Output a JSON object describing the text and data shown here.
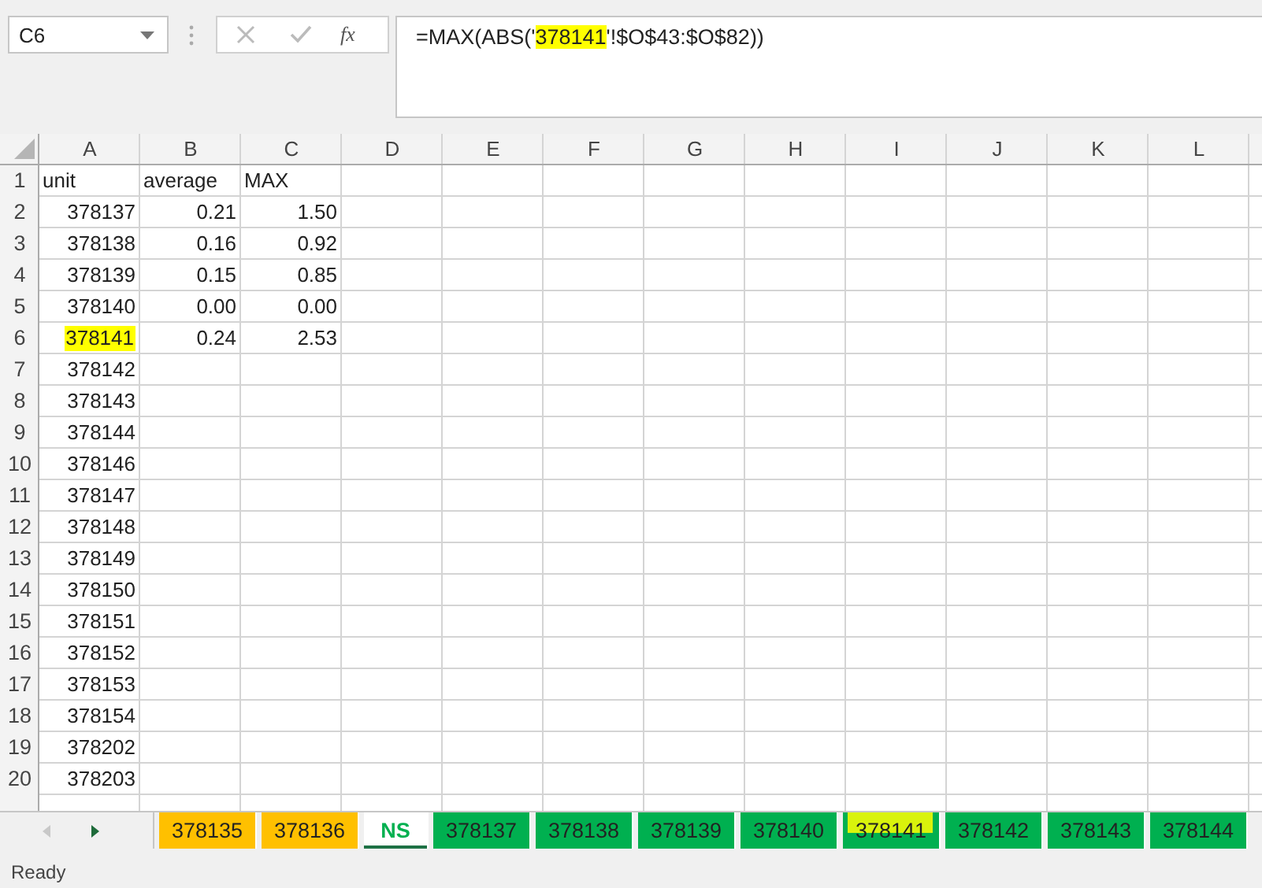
{
  "name_box": {
    "value": "C6"
  },
  "function_label": "fx",
  "formula": [
    {
      "text": "=MAX(ABS('",
      "highlighted": false
    },
    {
      "text": "378141",
      "highlighted": true
    },
    {
      "text": "'!$O$43:$O$82))",
      "highlighted": false
    }
  ],
  "columns": [
    "A",
    "B",
    "C",
    "D",
    "E",
    "F",
    "G",
    "H",
    "I",
    "J",
    "K",
    "L"
  ],
  "rows": [
    {
      "number": "1",
      "kind": "text",
      "cells": [
        {
          "text": "unit",
          "highlighted": false
        },
        {
          "text": "average",
          "highlighted": false
        },
        {
          "text": "MAX",
          "highlighted": false
        }
      ]
    },
    {
      "number": "2",
      "kind": "number",
      "cells": [
        {
          "text": "378137",
          "highlighted": false
        },
        {
          "text": "0.21",
          "highlighted": false
        },
        {
          "text": "1.50",
          "highlighted": false
        }
      ]
    },
    {
      "number": "3",
      "kind": "number",
      "cells": [
        {
          "text": "378138",
          "highlighted": false
        },
        {
          "text": "0.16",
          "highlighted": false
        },
        {
          "text": "0.92",
          "highlighted": false
        }
      ]
    },
    {
      "number": "4",
      "kind": "number",
      "cells": [
        {
          "text": "378139",
          "highlighted": false
        },
        {
          "text": "0.15",
          "highlighted": false
        },
        {
          "text": "0.85",
          "highlighted": false
        }
      ]
    },
    {
      "number": "5",
      "kind": "number",
      "cells": [
        {
          "text": "378140",
          "highlighted": false
        },
        {
          "text": "0.00",
          "highlighted": false
        },
        {
          "text": "0.00",
          "highlighted": false
        }
      ]
    },
    {
      "number": "6",
      "kind": "number",
      "cells": [
        {
          "text": "378141",
          "highlighted": true
        },
        {
          "text": "0.24",
          "highlighted": false
        },
        {
          "text": "2.53",
          "highlighted": false
        }
      ]
    },
    {
      "number": "7",
      "kind": "number",
      "cells": [
        {
          "text": "378142",
          "highlighted": false
        }
      ]
    },
    {
      "number": "8",
      "kind": "number",
      "cells": [
        {
          "text": "378143",
          "highlighted": false
        }
      ]
    },
    {
      "number": "9",
      "kind": "number",
      "cells": [
        {
          "text": "378144",
          "highlighted": false
        }
      ]
    },
    {
      "number": "10",
      "kind": "number",
      "cells": [
        {
          "text": "378146",
          "highlighted": false
        }
      ]
    },
    {
      "number": "11",
      "kind": "number",
      "cells": [
        {
          "text": "378147",
          "highlighted": false
        }
      ]
    },
    {
      "number": "12",
      "kind": "number",
      "cells": [
        {
          "text": "378148",
          "highlighted": false
        }
      ]
    },
    {
      "number": "13",
      "kind": "number",
      "cells": [
        {
          "text": "378149",
          "highlighted": false
        }
      ]
    },
    {
      "number": "14",
      "kind": "number",
      "cells": [
        {
          "text": "378150",
          "highlighted": false
        }
      ]
    },
    {
      "number": "15",
      "kind": "number",
      "cells": [
        {
          "text": "378151",
          "highlighted": false
        }
      ]
    },
    {
      "number": "16",
      "kind": "number",
      "cells": [
        {
          "text": "378152",
          "highlighted": false
        }
      ]
    },
    {
      "number": "17",
      "kind": "number",
      "cells": [
        {
          "text": "378153",
          "highlighted": false
        }
      ]
    },
    {
      "number": "18",
      "kind": "number",
      "cells": [
        {
          "text": "378154",
          "highlighted": false
        }
      ]
    },
    {
      "number": "19",
      "kind": "number",
      "cells": [
        {
          "text": "378202",
          "highlighted": false
        }
      ]
    },
    {
      "number": "20",
      "kind": "number",
      "cells": [
        {
          "text": "378203",
          "highlighted": false
        }
      ]
    }
  ],
  "sheet_tabs": [
    {
      "label": "378135",
      "color": "#ffc000",
      "selected": false,
      "highlighted": false
    },
    {
      "label": "378136",
      "color": "#ffc000",
      "selected": false,
      "highlighted": false
    },
    {
      "label": "NS",
      "color": "#00b050",
      "selected": true,
      "highlighted": false
    },
    {
      "label": "378137",
      "color": "#00b050",
      "selected": false,
      "highlighted": false
    },
    {
      "label": "378138",
      "color": "#00b050",
      "selected": false,
      "highlighted": false
    },
    {
      "label": "378139",
      "color": "#00b050",
      "selected": false,
      "highlighted": false
    },
    {
      "label": "378140",
      "color": "#00b050",
      "selected": false,
      "highlighted": false
    },
    {
      "label": "378141",
      "color": "#00b050",
      "selected": false,
      "highlighted": true
    },
    {
      "label": "378142",
      "color": "#00b050",
      "selected": false,
      "highlighted": false
    },
    {
      "label": "378143",
      "color": "#00b050",
      "selected": false,
      "highlighted": false
    },
    {
      "label": "378144",
      "color": "#00b050",
      "selected": false,
      "highlighted": false
    }
  ],
  "status_bar": {
    "text": "Ready"
  }
}
